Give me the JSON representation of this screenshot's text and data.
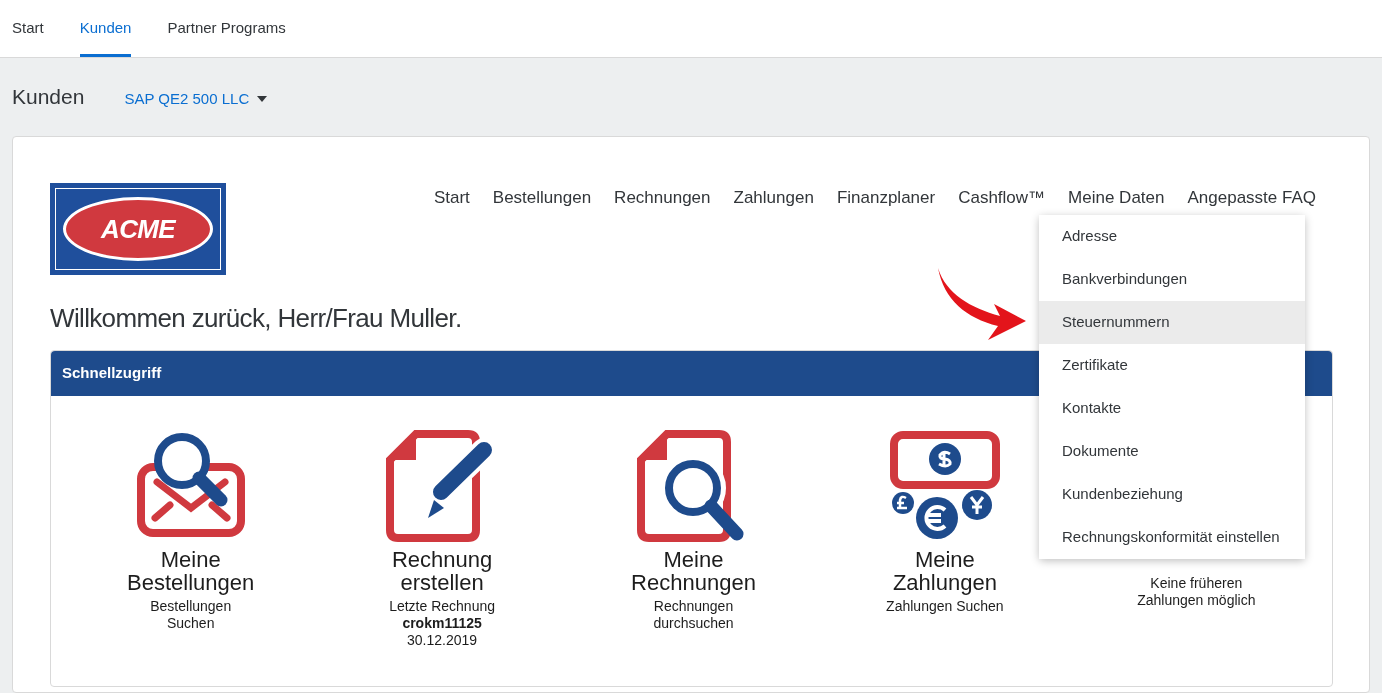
{
  "tabs": [
    {
      "label": "Start",
      "selected": false
    },
    {
      "label": "Kunden",
      "selected": true
    },
    {
      "label": "Partner Programs",
      "selected": false
    }
  ],
  "header": {
    "title": "Kunden",
    "account": "SAP QE2 500 LLC"
  },
  "logo": {
    "text": "ACME"
  },
  "nav": [
    {
      "label": "Start"
    },
    {
      "label": "Bestellungen"
    },
    {
      "label": "Rechnungen"
    },
    {
      "label": "Zahlungen"
    },
    {
      "label": "Finanzplaner"
    },
    {
      "label": "Cashflow™"
    },
    {
      "label": "Meine Daten"
    },
    {
      "label": "Angepasste FAQ"
    }
  ],
  "welcome": "Willkommen zurück, Herr/Frau Muller.",
  "quick_access": {
    "title": "Schnellzugriff",
    "tiles": [
      {
        "kind": "envelope-search",
        "title": "Meine\nBestellungen",
        "subtitle": "Bestellungen\nSuchen"
      },
      {
        "kind": "document-pen",
        "title": "Rechnung\nerstellen",
        "subtitle": "Letzte Rechnung\n**crokm11125**\n30.12.2019"
      },
      {
        "kind": "document-search",
        "title": "Meine\nRechnungen",
        "subtitle": "Rechnungen\ndurchsuchen"
      },
      {
        "kind": "money",
        "title": "Meine\nZahlungen",
        "subtitle": "Zahlungen Suchen"
      },
      {
        "subtitle": "Keine früheren\nZahlungen möglich"
      }
    ]
  },
  "menu": {
    "items": [
      {
        "label": "Adresse",
        "selected": false
      },
      {
        "label": "Bankverbindungen",
        "selected": false
      },
      {
        "label": "Steuernummern",
        "selected": true
      },
      {
        "label": "Zertifikate",
        "selected": false
      },
      {
        "label": "Kontakte",
        "selected": false
      },
      {
        "label": "Dokumente",
        "selected": false
      },
      {
        "label": "Kundenbeziehung",
        "selected": false
      },
      {
        "label": "Rechnungskonformität einstellen",
        "selected": false
      }
    ]
  }
}
